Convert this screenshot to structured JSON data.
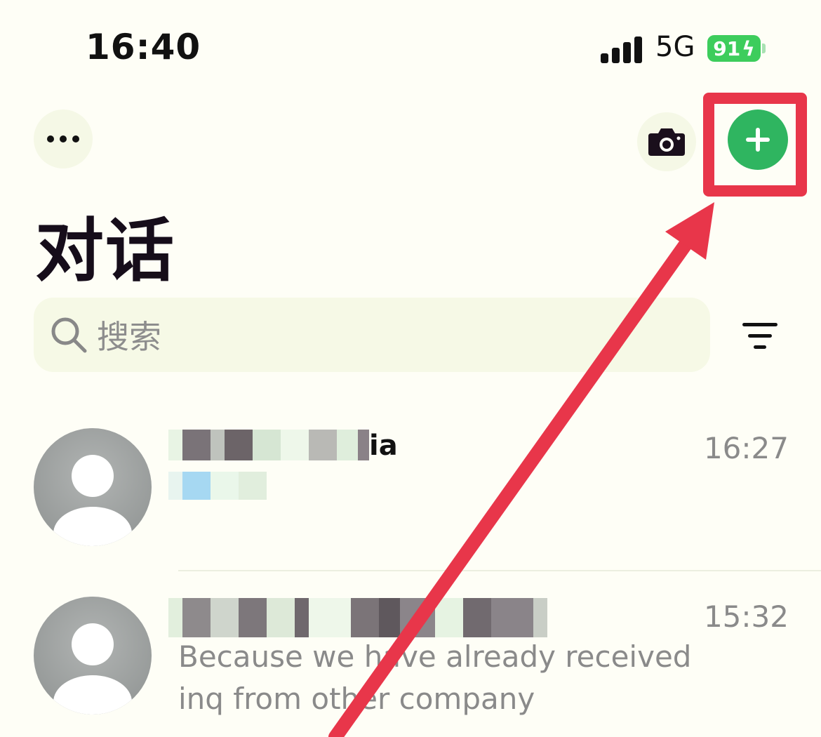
{
  "status_bar": {
    "time": "16:40",
    "network": "5G",
    "battery": "91"
  },
  "header": {
    "title": "对话",
    "more_icon": "ellipsis-icon",
    "camera_icon": "camera-icon",
    "add_icon": "plus-icon"
  },
  "search": {
    "placeholder": "搜索"
  },
  "conversations": [
    {
      "name_suffix": "ia",
      "time": "16:27",
      "preview": ""
    },
    {
      "name_suffix": "",
      "time": "15:32",
      "preview": "Because we have already received inq from other company"
    }
  ],
  "colors": {
    "accent_green": "#2fb560",
    "annotation_red": "#e8364a",
    "battery_green": "#3dcd5c"
  }
}
